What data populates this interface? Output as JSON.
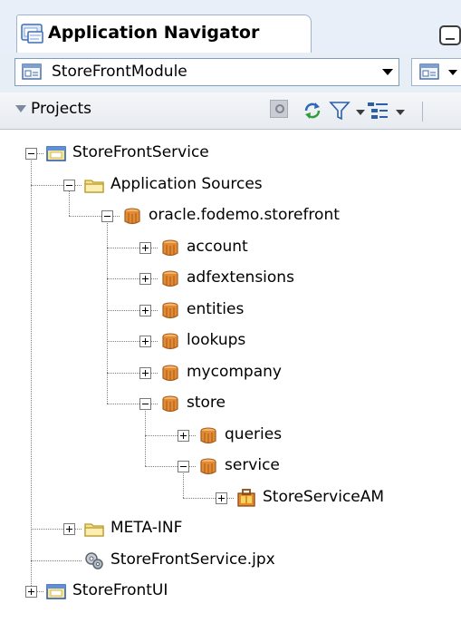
{
  "panel": {
    "title": "Application Navigator",
    "tab_icon": "application-navigator-icon",
    "minimize_icon": "minimize-icon"
  },
  "module_selector": {
    "value": "StoreFrontModule",
    "icon": "module-icon"
  },
  "projects_bar": {
    "label": "Projects",
    "toolbar_icons": [
      "find-icon",
      "sync-icon",
      "filter-icon",
      "navigator-options-icon"
    ]
  },
  "tree": {
    "nodes": [
      {
        "label": "StoreFrontService",
        "depth": 0,
        "icon": "project-icon",
        "expanded": true
      },
      {
        "label": "Application Sources",
        "depth": 1,
        "icon": "folder-icon",
        "expanded": true
      },
      {
        "label": "oracle.fodemo.storefront",
        "depth": 2,
        "icon": "package-icon",
        "expanded": true
      },
      {
        "label": "account",
        "depth": 3,
        "icon": "package-icon",
        "expanded": false
      },
      {
        "label": "adfextensions",
        "depth": 3,
        "icon": "package-icon",
        "expanded": false
      },
      {
        "label": "entities",
        "depth": 3,
        "icon": "package-icon",
        "expanded": false
      },
      {
        "label": "lookups",
        "depth": 3,
        "icon": "package-icon",
        "expanded": false
      },
      {
        "label": "mycompany",
        "depth": 3,
        "icon": "package-icon",
        "expanded": false
      },
      {
        "label": "store",
        "depth": 3,
        "icon": "package-icon",
        "expanded": true
      },
      {
        "label": "queries",
        "depth": 4,
        "icon": "package-icon",
        "expanded": false
      },
      {
        "label": "service",
        "depth": 4,
        "icon": "package-icon",
        "expanded": true
      },
      {
        "label": "StoreServiceAM",
        "depth": 5,
        "icon": "application-module-icon",
        "expanded": false
      },
      {
        "label": "META-INF",
        "depth": 1,
        "icon": "folder-icon",
        "expanded": false
      },
      {
        "label": "StoreFrontService.jpx",
        "depth": 1,
        "icon": "project-file-icon",
        "expanded": null
      },
      {
        "label": "StoreFrontUI",
        "depth": 0,
        "icon": "project-icon",
        "expanded": false
      }
    ]
  }
}
